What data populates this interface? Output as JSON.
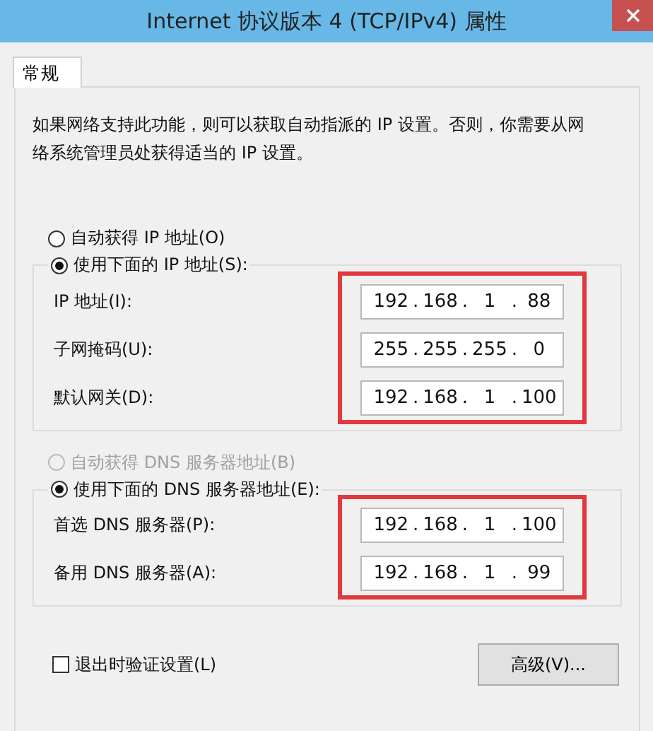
{
  "window": {
    "title": "Internet 协议版本 4 (TCP/IPv4) 属性"
  },
  "tabs": [
    {
      "label": "常规",
      "selected": true
    }
  ],
  "description": "如果网络支持此功能，则可以获取自动指派的 IP 设置。否则，你需要从网络系统管理员处获得适当的 IP 设置。",
  "octet_separator": ".",
  "sections": [
    {
      "options": [
        {
          "label": "自动获得 IP 地址(O)",
          "selected": false,
          "disabled": false
        },
        {
          "label": "使用下面的 IP 地址(S):",
          "selected": true,
          "disabled": false
        }
      ],
      "highlighted": true,
      "fields": [
        {
          "label": "IP 地址(I):",
          "octets": [
            "192",
            "168",
            "1",
            "88"
          ]
        },
        {
          "label": "子网掩码(U):",
          "octets": [
            "255",
            "255",
            "255",
            "0"
          ]
        },
        {
          "label": "默认网关(D):",
          "octets": [
            "192",
            "168",
            "1",
            "100"
          ]
        }
      ]
    },
    {
      "options": [
        {
          "label": "自动获得 DNS 服务器地址(B)",
          "selected": false,
          "disabled": true
        },
        {
          "label": "使用下面的 DNS 服务器地址(E):",
          "selected": true,
          "disabled": false
        }
      ],
      "highlighted": true,
      "fields": [
        {
          "label": "首选 DNS 服务器(P):",
          "octets": [
            "192",
            "168",
            "1",
            "100"
          ]
        },
        {
          "label": "备用 DNS 服务器(A):",
          "octets": [
            "192",
            "168",
            "1",
            "99"
          ]
        }
      ]
    }
  ],
  "verify_on_exit": {
    "label": "退出时验证设置(L)",
    "checked": false
  },
  "advanced_button": "高级(V)..."
}
